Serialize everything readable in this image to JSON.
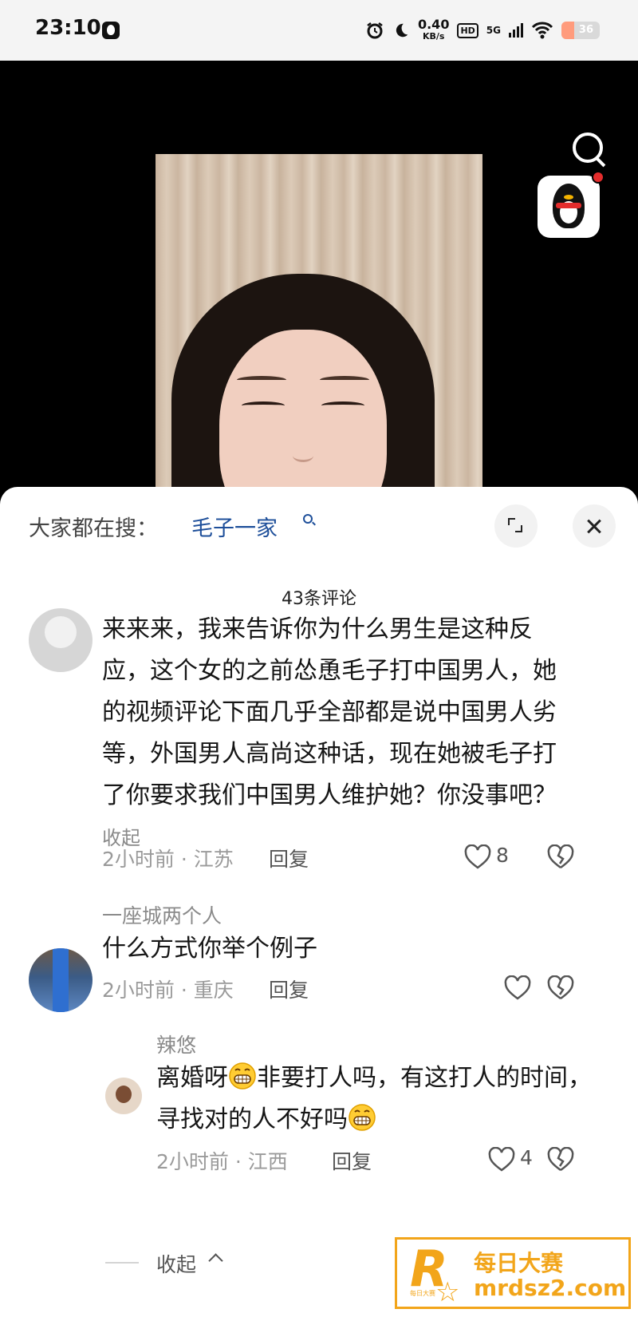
{
  "status_bar": {
    "time": "23:10",
    "net_speed_value": "0.40",
    "net_speed_unit": "KB/s",
    "hd_label": "HD",
    "network_label": "5G",
    "battery_level": "36",
    "icons": [
      "alarm-icon",
      "moon-icon",
      "signal-icon",
      "wifi-icon",
      "battery-icon"
    ]
  },
  "video": {
    "search_icon": "search-icon",
    "badge_icon": "qq-penguin-icon"
  },
  "search_bar": {
    "prefix": "大家都在搜：",
    "term": "毛子一家"
  },
  "comments_header": {
    "count_label": "43条评论"
  },
  "comments": [
    {
      "author": "",
      "text": "来来来，我来告诉你为什么男生是这种反应，这个女的之前怂恿毛子打中国男人，她的视频评论下面几乎全部都是说中国男人劣等，外国男人高尚这种话，现在她被毛子打了你要求我们中国男人维护她？你没事吧？",
      "collapse_label": "收起",
      "time_location": "2小时前 · 江苏",
      "reply_label": "回复",
      "likes": "8"
    },
    {
      "author": "一座城两个人",
      "text": "什么方式你举个例子",
      "time_location": "2小时前 · 重庆",
      "reply_label": "回复",
      "likes": ""
    }
  ],
  "replies": [
    {
      "author": "辣悠",
      "text_part1": "离婚呀",
      "text_part2": "非要打人吗，有这打人的时间，寻找对的人不好吗",
      "emoji": "grinning-face-icon",
      "time_location": "2小时前 · 江西",
      "reply_label": "回复",
      "likes": "4"
    }
  ],
  "collapse_replies_label": "收起",
  "watermark": {
    "logo_letter": "R",
    "logo_sub": "每日大赛",
    "title": "每日大赛",
    "url": "mrdsz2.com"
  },
  "colors": {
    "link_blue": "#1e4f9a",
    "watermark_orange": "#f2a51a"
  }
}
